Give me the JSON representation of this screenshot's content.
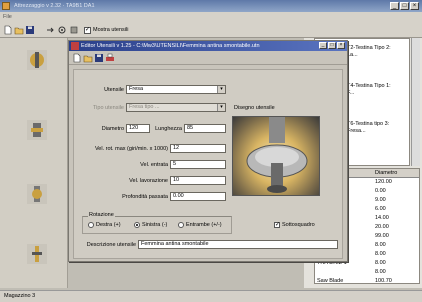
{
  "main_window": {
    "title": "Attrezzaggio v 2.32 · TA9B1 DA1",
    "menu": [
      "File"
    ],
    "toolbar_checkbox_label": "Mostra utensili"
  },
  "dialog": {
    "title": "Editor Utensili v 1.25 - C:\\Mw3\\UTENSILI\\Femmina antina smontabile.utn",
    "fields": {
      "utensile_label": "Utensile",
      "utensile_value": "Fresa",
      "tipo_label": "Tipo utensile",
      "tipo_value": "Fresa tipo ...",
      "diametro_label": "Diametro",
      "diametro_value": "120",
      "lunghezza_label": "Lunghezza",
      "lunghezza_value": "85",
      "vel_rot_label": "Vel. rot. max (giri/min. x 1000)",
      "vel_rot_value": "12",
      "vel_entrata_label": "Vel. entrata",
      "vel_entrata_value": "5",
      "vel_lavorazione_label": "Vel. lavorazione",
      "vel_lavorazione_value": "10",
      "profondita_label": "Profondità passata",
      "profondita_value": "0.00",
      "descrizione_label": "Descrizione utensile",
      "descrizione_value": "Femmina antina smontabile"
    },
    "disegno_label": "Disegno utensile",
    "rotazione": {
      "label": "Rotazione",
      "options": [
        "Destra (+)",
        "Sinistra (-)",
        "Entrambe (+/-)"
      ],
      "selected": "Sinistra (-)"
    },
    "sottosquadro": {
      "label": "Sottosquadro",
      "checked": true
    }
  },
  "right_panel": {
    "icons": [
      {
        "label": "T2-Testina Tipo 2: La...",
        "color": "#e8c400"
      },
      {
        "label": "T4-Testina Tipo 1: F...",
        "color": "#e8c400"
      },
      {
        "label": "T6-Testina tipo 3: Fresa...",
        "color": "#cc2020"
      }
    ],
    "table_header": "Diametro",
    "rows": [
      {
        "name": "ont",
        "diam": "120.00"
      },
      {
        "name": "a smontabile",
        "diam": "0.00"
      },
      {
        "name": "",
        "diam": "9.00"
      },
      {
        "name": "",
        "diam": "6.00"
      },
      {
        "name": "",
        "diam": "14.00"
      },
      {
        "name": "",
        "diam": "20.00"
      },
      {
        "name": "a smontabile",
        "diam": "99.00"
      },
      {
        "name": "",
        "diam": "8.00"
      },
      {
        "name": "a 8",
        "diam": "8.00"
      },
      {
        "name": "TRA DRIZ 1",
        "diam": "8.00"
      },
      {
        "name": "",
        "diam": "8.00"
      },
      {
        "name": "Saw Blade",
        "diam": "100.70"
      }
    ]
  },
  "status_bar": "Magazzino 3"
}
